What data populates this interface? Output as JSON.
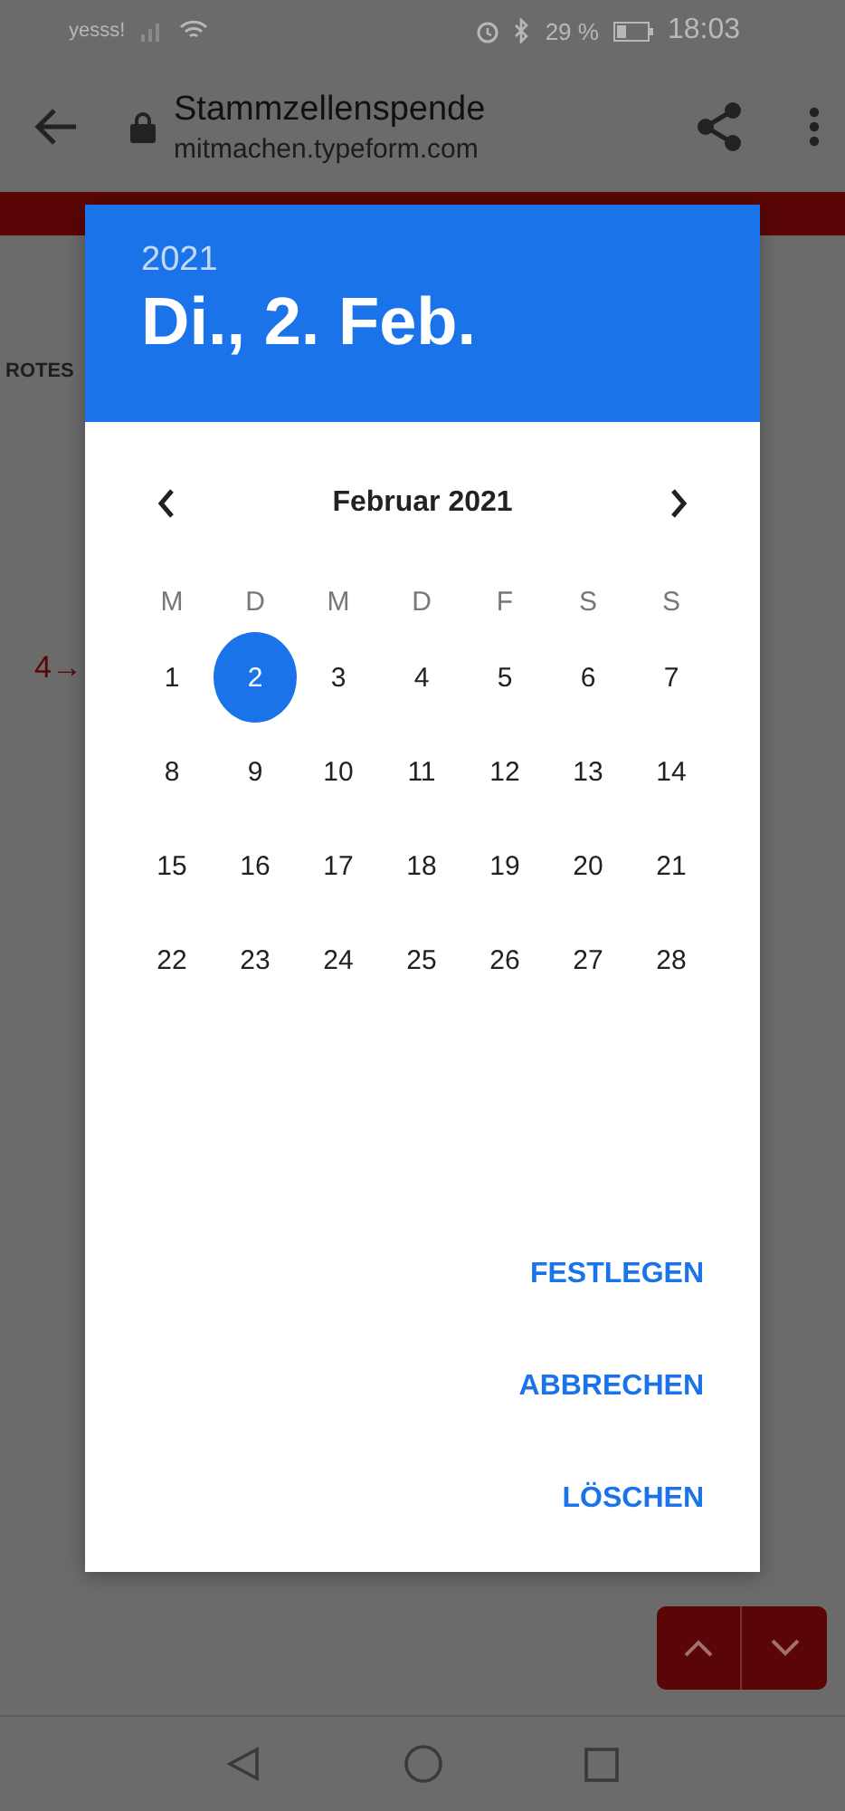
{
  "status_bar": {
    "carrier": "yesss!",
    "battery": "29 %",
    "time": "18:03"
  },
  "browser": {
    "title": "Stammzellenspende",
    "url": "mitmachen.typeform.com"
  },
  "page": {
    "heading": "ROTES",
    "question_number": "4→"
  },
  "date_picker": {
    "year": "2021",
    "date": "Di., 2. Feb.",
    "month": "Februar 2021",
    "weekdays": [
      "M",
      "D",
      "M",
      "D",
      "F",
      "S",
      "S"
    ],
    "days": [
      {
        "label": "1",
        "selected": false
      },
      {
        "label": "2",
        "selected": true
      },
      {
        "label": "3",
        "selected": false
      },
      {
        "label": "4",
        "selected": false
      },
      {
        "label": "5",
        "selected": false
      },
      {
        "label": "6",
        "selected": false
      },
      {
        "label": "7",
        "selected": false
      },
      {
        "label": "8",
        "selected": false
      },
      {
        "label": "9",
        "selected": false
      },
      {
        "label": "10",
        "selected": false
      },
      {
        "label": "11",
        "selected": false
      },
      {
        "label": "12",
        "selected": false
      },
      {
        "label": "13",
        "selected": false
      },
      {
        "label": "14",
        "selected": false
      },
      {
        "label": "15",
        "selected": false
      },
      {
        "label": "16",
        "selected": false
      },
      {
        "label": "17",
        "selected": false
      },
      {
        "label": "18",
        "selected": false
      },
      {
        "label": "19",
        "selected": false
      },
      {
        "label": "20",
        "selected": false
      },
      {
        "label": "21",
        "selected": false
      },
      {
        "label": "22",
        "selected": false
      },
      {
        "label": "23",
        "selected": false
      },
      {
        "label": "24",
        "selected": false
      },
      {
        "label": "25",
        "selected": false
      },
      {
        "label": "26",
        "selected": false
      },
      {
        "label": "27",
        "selected": false
      },
      {
        "label": "28",
        "selected": false
      }
    ],
    "buttons": [
      "FESTLEGEN",
      "ABBRECHEN",
      "LÖSCHEN"
    ]
  }
}
